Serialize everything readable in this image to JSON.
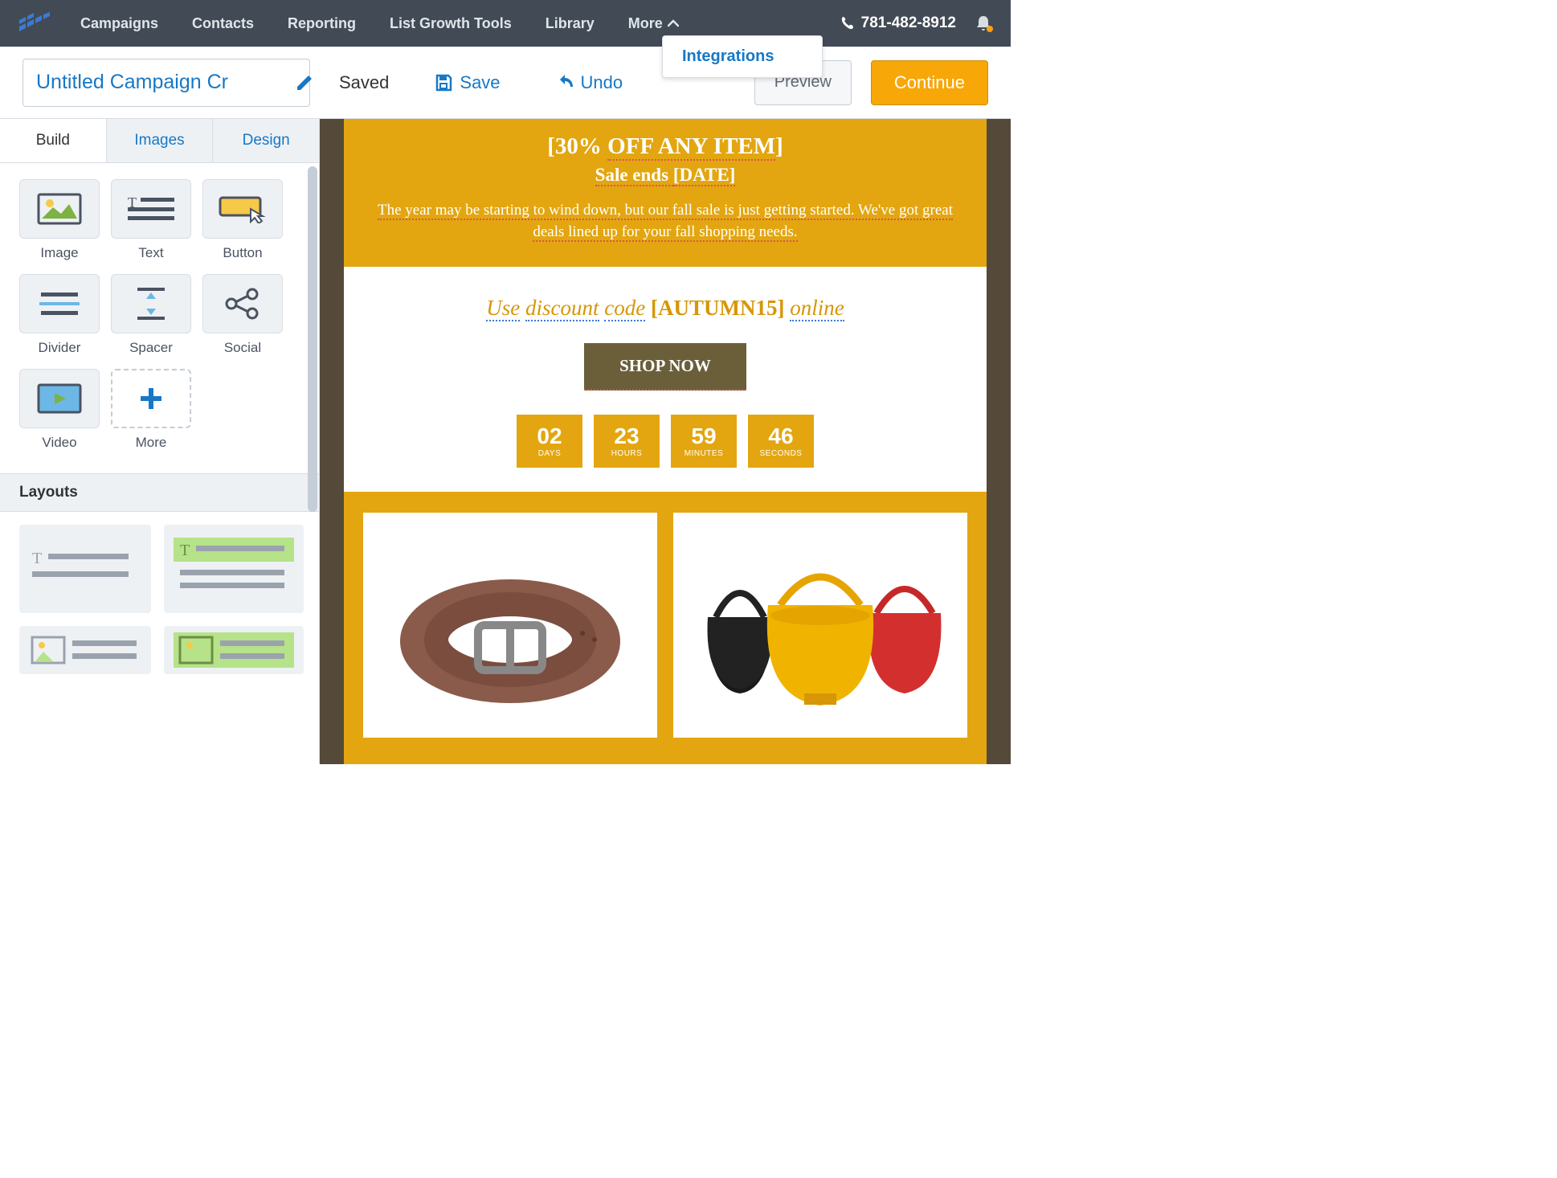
{
  "nav": {
    "items": [
      "Campaigns",
      "Contacts",
      "Reporting",
      "List Growth Tools",
      "Library",
      "More"
    ],
    "phone": "781-482-8912",
    "more_dropdown": {
      "item": "Integrations"
    }
  },
  "toolbar": {
    "campaign_name": "Untitled Campaign Cr",
    "saved": "Saved",
    "save": "Save",
    "undo": "Undo",
    "preview": "Preview",
    "continue": "Continue"
  },
  "sidebar": {
    "tabs": {
      "build": "Build",
      "images": "Images",
      "design": "Design"
    },
    "blocks": [
      {
        "label": "Image"
      },
      {
        "label": "Text"
      },
      {
        "label": "Button"
      },
      {
        "label": "Divider"
      },
      {
        "label": "Spacer"
      },
      {
        "label": "Social"
      },
      {
        "label": "Video"
      },
      {
        "label": "More"
      }
    ],
    "layouts_heading": "Layouts"
  },
  "email": {
    "hero": {
      "headline_prefix": "[30% ",
      "headline_underline": "OFF ANY ITEM",
      "headline_suffix": "]",
      "subhead_prefix": "Sale ends ",
      "subhead_date": "[DATE]",
      "body": "The year may be starting to wind down, but our fall sale is just getting started. We've got great deals lined up for your fall shopping needs."
    },
    "promo": {
      "use": "Use",
      "discount": "discount",
      "code": "code",
      "code_value": "[AUTUMN15]",
      "online": "online",
      "cta": "SHOP NOW"
    },
    "countdown": {
      "days": {
        "value": "02",
        "label": "DAYS"
      },
      "hours": {
        "value": "23",
        "label": "HOURS"
      },
      "minutes": {
        "value": "59",
        "label": "MINUTES"
      },
      "seconds": {
        "value": "46",
        "label": "SECONDS"
      }
    }
  }
}
